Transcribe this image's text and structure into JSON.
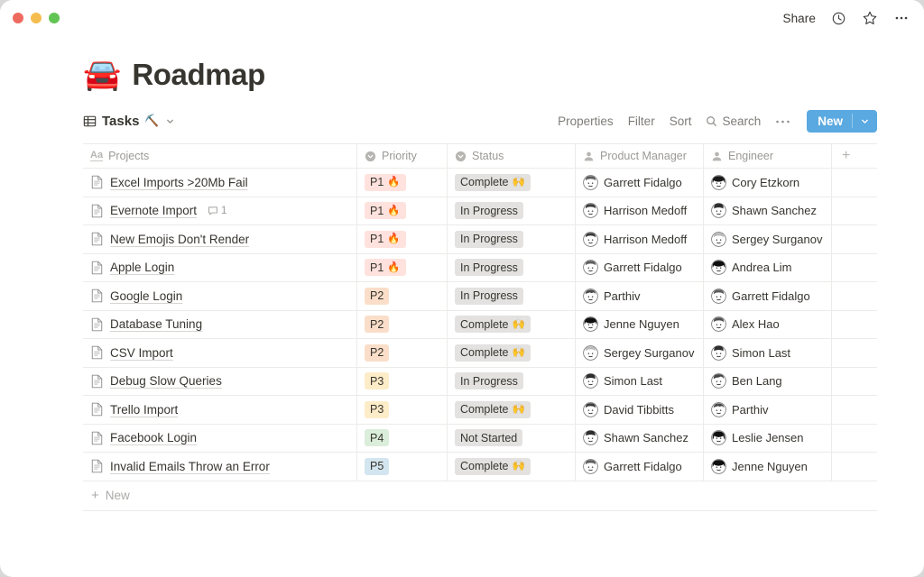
{
  "window": {
    "traffic_lights": [
      "close",
      "minimize",
      "maximize"
    ],
    "colors": {
      "close": "#ee6a5f",
      "minimize": "#f5bd4f",
      "maximize": "#61c454"
    }
  },
  "titlebar": {
    "share_label": "Share",
    "icons": [
      "clock-icon",
      "star-icon",
      "more-icon"
    ]
  },
  "page": {
    "emoji": "🚘",
    "title": "Roadmap"
  },
  "viewbar": {
    "view_name": "Tasks",
    "view_emoji": "⛏️",
    "properties_label": "Properties",
    "filter_label": "Filter",
    "sort_label": "Sort",
    "search_label": "Search",
    "more_label": "⋯",
    "new_label": "New",
    "new_button_color": "#5aa9e0"
  },
  "table": {
    "columns": [
      {
        "label": "Projects",
        "icon": "text-property-icon"
      },
      {
        "label": "Priority",
        "icon": "select-property-icon"
      },
      {
        "label": "Status",
        "icon": "select-property-icon"
      },
      {
        "label": "Product Manager",
        "icon": "person-property-icon"
      },
      {
        "label": "Engineer",
        "icon": "person-property-icon"
      }
    ],
    "add_column_label": "+",
    "new_row_label": "New",
    "tag_colors": {
      "P1": "#ffe2dd",
      "P2": "#fadec9",
      "P3": "#fdecc8",
      "P4": "#dbeddb",
      "P5": "#d3e5ef",
      "status": "#e3e2e0"
    },
    "rows": [
      {
        "project": "Excel Imports >20Mb Fail",
        "comments": null,
        "priority": "P1",
        "priority_emoji": "🔥",
        "status": "Complete",
        "status_emoji": "🙌",
        "pm": "Garrett Fidalgo",
        "pm_avatar": "male-light-brown-hair",
        "eng": "Cory Etzkorn",
        "eng_avatar": "female-dark-hair"
      },
      {
        "project": "Evernote Import",
        "comments": "1",
        "priority": "P1",
        "priority_emoji": "🔥",
        "status": "In Progress",
        "status_emoji": "",
        "pm": "Harrison Medoff",
        "pm_avatar": "male-dark-hair",
        "eng": "Shawn Sanchez",
        "eng_avatar": "male-short-dark-hair"
      },
      {
        "project": "New Emojis Don't Render",
        "comments": null,
        "priority": "P1",
        "priority_emoji": "🔥",
        "status": "In Progress",
        "status_emoji": "",
        "pm": "Harrison Medoff",
        "pm_avatar": "male-dark-hair",
        "eng": "Sergey Surganov",
        "eng_avatar": "male-light-hair"
      },
      {
        "project": "Apple Login",
        "comments": null,
        "priority": "P1",
        "priority_emoji": "🔥",
        "status": "In Progress",
        "status_emoji": "",
        "pm": "Garrett Fidalgo",
        "pm_avatar": "male-light-brown-hair",
        "eng": "Andrea Lim",
        "eng_avatar": "female-black-bob"
      },
      {
        "project": "Google Login",
        "comments": null,
        "priority": "P2",
        "priority_emoji": "",
        "status": "In Progress",
        "status_emoji": "",
        "pm": "Parthiv",
        "pm_avatar": "male-curly-hair",
        "eng": "Garrett Fidalgo",
        "eng_avatar": "male-light-brown-hair"
      },
      {
        "project": "Database Tuning",
        "comments": null,
        "priority": "P2",
        "priority_emoji": "",
        "status": "Complete",
        "status_emoji": "🙌",
        "pm": "Jenne Nguyen",
        "pm_avatar": "female-black-bob",
        "eng": "Alex Hao",
        "eng_avatar": "male-round-face"
      },
      {
        "project": "CSV Import",
        "comments": null,
        "priority": "P2",
        "priority_emoji": "",
        "status": "Complete",
        "status_emoji": "🙌",
        "pm": "Sergey Surganov",
        "pm_avatar": "male-light-hair",
        "eng": "Simon Last",
        "eng_avatar": "male-short-dark-hair"
      },
      {
        "project": "Debug Slow Queries",
        "comments": null,
        "priority": "P3",
        "priority_emoji": "",
        "status": "In Progress",
        "status_emoji": "",
        "pm": "Simon Last",
        "pm_avatar": "male-short-dark-hair",
        "eng": "Ben Lang",
        "eng_avatar": "male-parted-hair"
      },
      {
        "project": "Trello Import",
        "comments": null,
        "priority": "P3",
        "priority_emoji": "",
        "status": "Complete",
        "status_emoji": "🙌",
        "pm": "David Tibbitts",
        "pm_avatar": "male-dark-hair",
        "eng": "Parthiv",
        "eng_avatar": "male-curly-hair"
      },
      {
        "project": "Facebook Login",
        "comments": null,
        "priority": "P4",
        "priority_emoji": "",
        "status": "Not Started",
        "status_emoji": "",
        "pm": "Shawn Sanchez",
        "pm_avatar": "male-short-dark-hair",
        "eng": "Leslie Jensen",
        "eng_avatar": "female-long-black-hair"
      },
      {
        "project": "Invalid Emails Throw an Error",
        "comments": null,
        "priority": "P5",
        "priority_emoji": "",
        "status": "Complete",
        "status_emoji": "🙌",
        "pm": "Garrett Fidalgo",
        "pm_avatar": "male-light-brown-hair",
        "eng": "Jenne Nguyen",
        "eng_avatar": "female-black-bob"
      }
    ]
  }
}
